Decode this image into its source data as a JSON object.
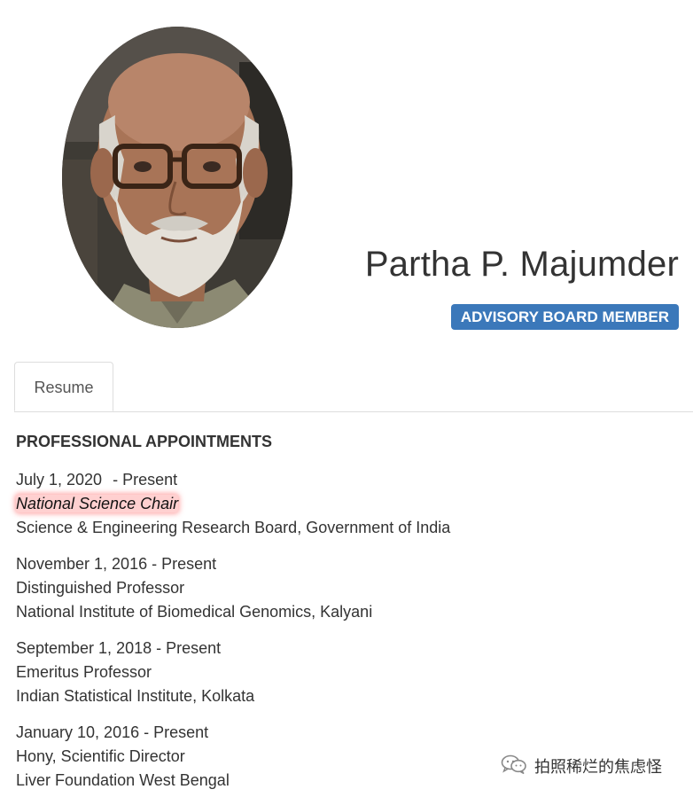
{
  "profile": {
    "name": "Partha P. Majumder",
    "badge": "ADVISORY BOARD MEMBER",
    "badge_color": "#3b78ba"
  },
  "tabs": [
    {
      "label": "Resume",
      "active": true
    }
  ],
  "resume": {
    "section_title": "PROFESSIONAL APPOINTMENTS",
    "entries": [
      {
        "date": "July 1, 2020",
        "present": "- Present",
        "title": "National Science Chair",
        "org": "Science & Engineering Research Board, Government of India"
      },
      {
        "date": "November 1, 2016",
        "present": "- Present",
        "title": "Distinguished Professor",
        "org": "National Institute of Biomedical Genomics, Kalyani"
      },
      {
        "date": "September 1, 2018",
        "present": "- Present",
        "title": "Emeritus Professor",
        "org": "Indian Statistical Institute, Kolkata"
      },
      {
        "date": "January 10, 2016",
        "present": "- Present",
        "title": "Hony, Scientific Director",
        "org": "Liver Foundation West Bengal"
      }
    ]
  },
  "watermark": {
    "text": "拍照稀烂的焦虑怪",
    "icon": "wechat-icon"
  }
}
